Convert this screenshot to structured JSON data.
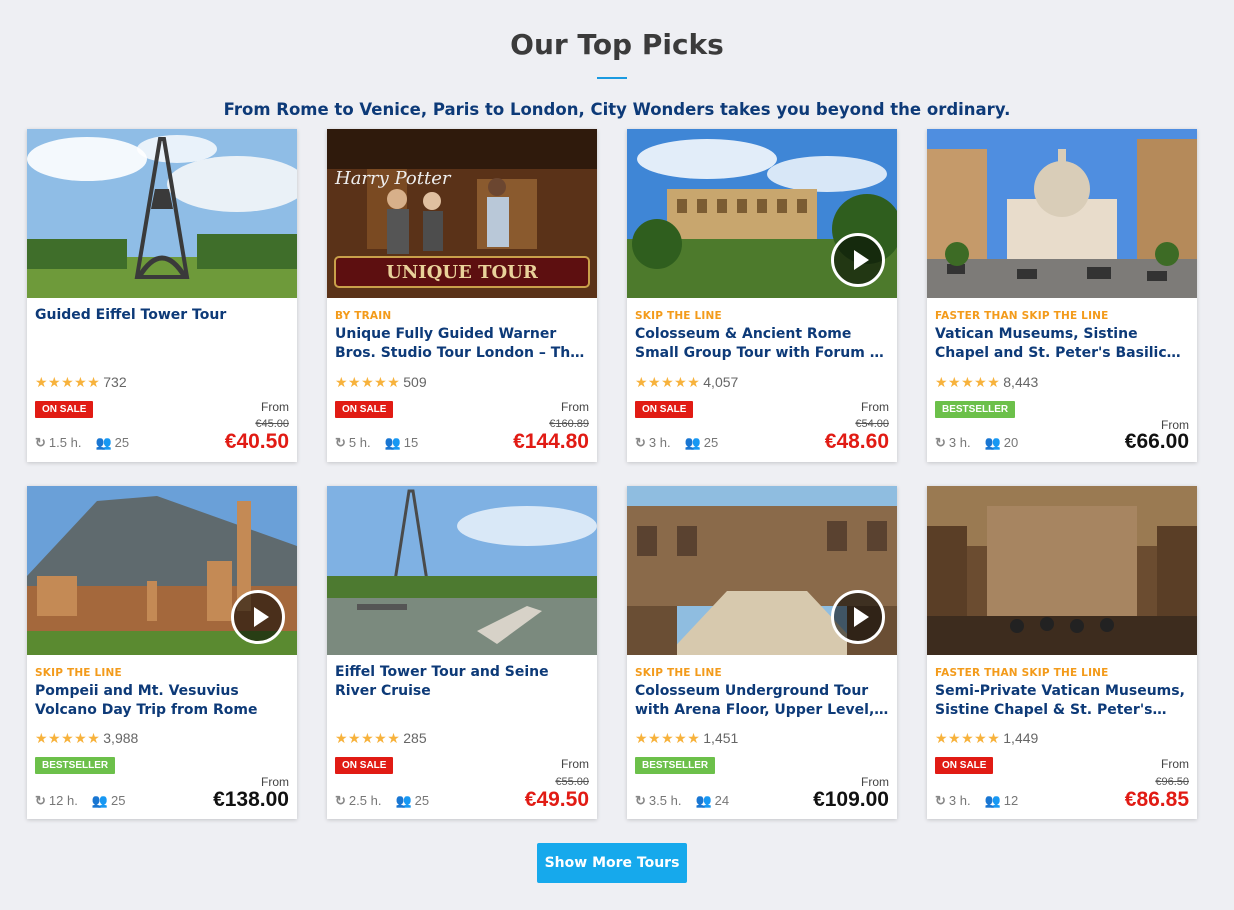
{
  "header": {
    "title": "Our Top Picks",
    "subtitle": "From Rome to Venice, Paris to London, City Wonders takes you beyond the ordinary."
  },
  "colors": {
    "accent": "#16a9ec",
    "title_blue": "#0d3a78",
    "sale_red": "#e11b14",
    "bestseller_green": "#6cc04a",
    "tag_orange": "#f39b1b",
    "star": "#f7b23c"
  },
  "tours": [
    {
      "tag": "",
      "title": "Guided Eiffel Tower Tour",
      "stars": "★★★★★",
      "reviews": "732",
      "badge": "ON SALE",
      "badge_type": "sale",
      "from": "From",
      "old_price": "€45.00",
      "price": "€40.50",
      "duration": "1.5 h.",
      "group": "25",
      "video": false
    },
    {
      "tag": "BY TRAIN",
      "title": "Unique Fully Guided Warner Bros. Studio Tour London – The Making of Harry Potter",
      "stars": "★★★★★",
      "reviews": "509",
      "badge": "ON SALE",
      "badge_type": "sale",
      "from": "From",
      "old_price": "€160.89",
      "price": "€144.80",
      "duration": "5 h.",
      "group": "15",
      "video": false,
      "image_text": "UNIQUE TOUR",
      "image_text2": "Harry Potter"
    },
    {
      "tag": "SKIP THE LINE",
      "title": "Colosseum & Ancient Rome Small Group Tour with Forum & Palatine Hill",
      "stars": "★★★★★",
      "reviews": "4,057",
      "badge": "ON SALE",
      "badge_type": "sale",
      "from": "From",
      "old_price": "€54.00",
      "price": "€48.60",
      "duration": "3 h.",
      "group": "25",
      "video": true
    },
    {
      "tag": "FASTER THAN SKIP THE LINE",
      "title": "Vatican Museums, Sistine Chapel and St. Peter's Basilica Tour",
      "stars": "★★★★★",
      "reviews": "8,443",
      "badge": "BESTSELLER",
      "badge_type": "best",
      "from": "From",
      "old_price": "",
      "price": "€66.00",
      "duration": "3 h.",
      "group": "20",
      "video": false
    },
    {
      "tag": "SKIP THE LINE",
      "title": "Pompeii and Mt. Vesuvius Volcano Day Trip from Rome",
      "stars": "★★★★★",
      "reviews": "3,988",
      "badge": "BESTSELLER",
      "badge_type": "best",
      "from": "From",
      "old_price": "",
      "price": "€138.00",
      "duration": "12 h.",
      "group": "25",
      "video": true
    },
    {
      "tag": "",
      "title": "Eiffel Tower Tour and Seine River Cruise",
      "stars": "★★★★★",
      "reviews": "285",
      "badge": "ON SALE",
      "badge_type": "sale",
      "from": "From",
      "old_price": "€55.00",
      "price": "€49.50",
      "duration": "2.5 h.",
      "group": "25",
      "video": false
    },
    {
      "tag": "SKIP THE LINE",
      "title": "Colosseum Underground Tour with Arena Floor, Upper Level, Roman Forum",
      "stars": "★★★★★",
      "reviews": "1,451",
      "badge": "BESTSELLER",
      "badge_type": "best",
      "from": "From",
      "old_price": "",
      "price": "€109.00",
      "duration": "3.5 h.",
      "group": "24",
      "video": true
    },
    {
      "tag": "FASTER THAN SKIP THE LINE",
      "title": "Semi-Private Vatican Museums, Sistine Chapel & St. Peter's Basilica",
      "stars": "★★★★★",
      "reviews": "1,449",
      "badge": "ON SALE",
      "badge_type": "sale",
      "from": "From",
      "old_price": "€96.50",
      "price": "€86.85",
      "duration": "3 h.",
      "group": "12",
      "video": false
    }
  ],
  "icons": {
    "duration": "clock-icon",
    "group": "group-icon",
    "play": "play-icon"
  },
  "footer": {
    "more_label": "Show More Tours"
  }
}
